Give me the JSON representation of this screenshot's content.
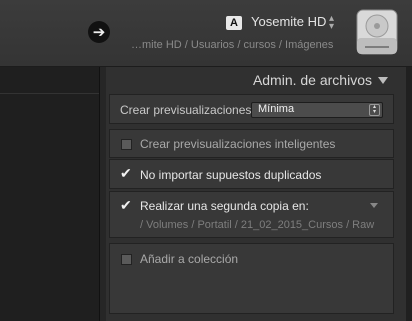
{
  "header": {
    "drive_letter": "A",
    "drive_name": "Yosemite HD",
    "drive_chevron": "⌃⌄",
    "path": "…mite HD / Usuarios / cursos / Imágenes",
    "back_icon": "arrow-right-icon",
    "disk_icon": "hard-drive-icon"
  },
  "panel": {
    "title": "Admin. de archivos",
    "previews": {
      "label": "Crear previsualizaciones",
      "selected": "Mínima"
    },
    "smart_previews": {
      "label": "Crear previsualizaciones inteligentes",
      "checked": false
    },
    "no_duplicates": {
      "label": "No importar supuestos duplicados",
      "checked": true
    },
    "second_copy": {
      "label": "Realizar una segunda copia en:",
      "checked": true,
      "path": "/ Volumes / Portatil  / 21_02_2015_Cursos / Raw"
    },
    "add_collection": {
      "label": "Añadir a colección",
      "checked": false
    }
  },
  "colors": {
    "background": "#2b2b2b",
    "panel": "#303030",
    "box": "#383838",
    "text": "#c9c9c9"
  }
}
